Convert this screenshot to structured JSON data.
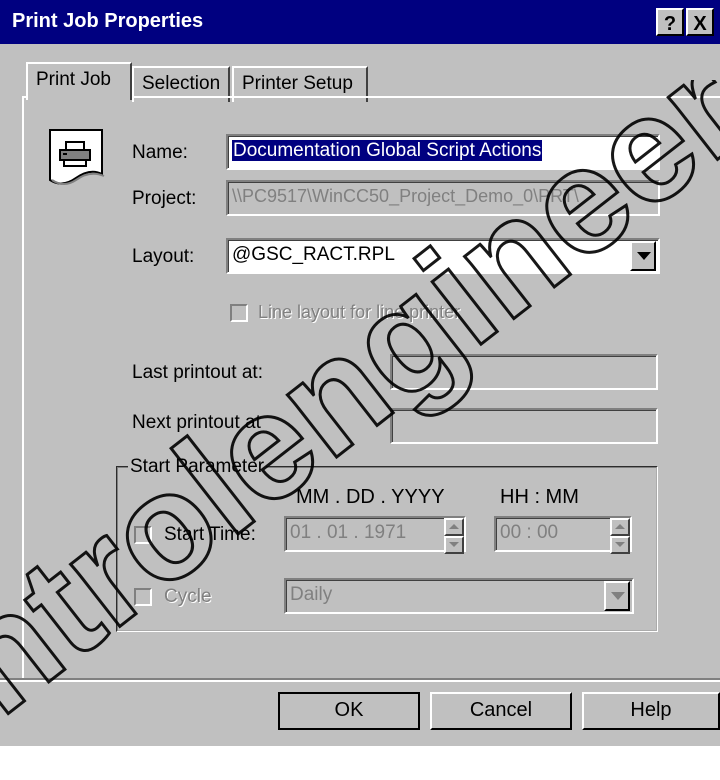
{
  "window": {
    "title": "Print Job Properties",
    "help_button": "?",
    "close_button": "X"
  },
  "tabs": [
    {
      "label": "Print Job",
      "active": true
    },
    {
      "label": "Selection",
      "active": false
    },
    {
      "label": "Printer Setup",
      "active": false
    }
  ],
  "form": {
    "name_label": "Name:",
    "name_value": "Documentation Global Script Actions",
    "project_label": "Project:",
    "project_value": "\\\\PC9517\\WinCC50_Project_Demo_0\\PRT\\",
    "layout_label": "Layout:",
    "layout_value": "@GSC_RACT.RPL",
    "line_layout_label": "Line layout for line printer",
    "last_printout_label": "Last printout at:",
    "last_printout_value": "",
    "next_printout_label": "Next printout at",
    "next_printout_value": ""
  },
  "start_parameter": {
    "group_label": "Start Parameter",
    "date_format": "MM . DD . YYYY",
    "time_format": "HH : MM",
    "start_time_label": "Start Time:",
    "start_date_value": "01 . 01 . 1971",
    "start_time_value": "00 : 00",
    "cycle_label": "Cycle",
    "cycle_value": "Daily"
  },
  "buttons": {
    "ok": "OK",
    "cancel": "Cancel",
    "help": "Help"
  },
  "watermark": {
    "text": "ntrolengineer"
  },
  "colors": {
    "titlebar": "#000080",
    "face": "#c0c0c0",
    "selection": "#000080",
    "disabled_text": "#808080"
  }
}
